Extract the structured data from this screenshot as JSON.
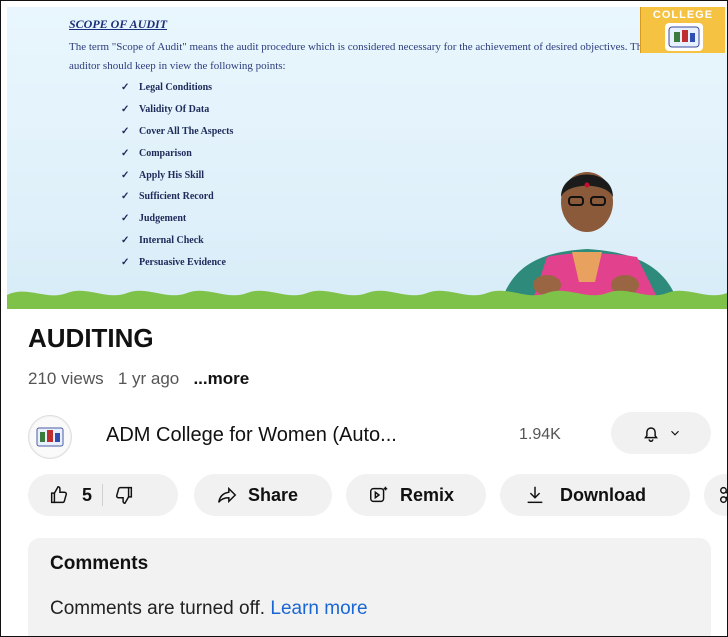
{
  "video": {
    "slide_title": "SCOPE OF AUDIT",
    "slide_paragraph": "The term \"Scope of Audit\" means the audit procedure which is considered necessary for the achievement of desired objectives. The auditor should keep in view the following points:",
    "bullets": [
      "Legal Conditions",
      "Validity Of Data",
      "Cover All The Aspects",
      "Comparison",
      "Apply His Skill",
      "Sufficient Record",
      "Judgement",
      "Internal Check",
      "Persuasive Evidence"
    ],
    "logo_text": "COLLEGE",
    "check_glyph": "✓"
  },
  "details": {
    "title": "AUDITING",
    "views": "210 views",
    "age": "1 yr ago",
    "more": "...more"
  },
  "channel": {
    "name": "ADM College for Women (Auto...",
    "subscribers": "1.94K"
  },
  "actions": {
    "likes": "5",
    "share": "Share",
    "remix": "Remix",
    "download": "Download"
  },
  "comments": {
    "heading": "Comments",
    "message": "Comments are turned off.",
    "link": "Learn more"
  },
  "colors": {
    "accent_link": "#1a66d2",
    "pill_bg": "#f1f1f1",
    "slide_text": "#1c2f7a"
  },
  "icons": [
    "thumbs-up-icon",
    "thumbs-down-icon",
    "share-icon",
    "remix-icon",
    "download-icon",
    "bell-icon",
    "chevron-down-icon"
  ]
}
